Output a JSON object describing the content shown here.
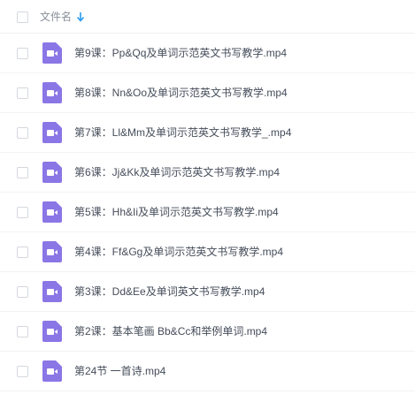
{
  "header": {
    "column_label": "文件名",
    "sort_icon": "arrow-down-icon",
    "sort_color": "#2b9cf2"
  },
  "file_icon": {
    "type": "video-file-icon",
    "color": "#8b76e6"
  },
  "files": [
    {
      "name": "第9课：Pp&Qq及单词示范英文书写教学.mp4"
    },
    {
      "name": "第8课：Nn&Oo及单词示范英文书写教学.mp4"
    },
    {
      "name": "第7课：Ll&Mm及单词示范英文书写教学_.mp4"
    },
    {
      "name": "第6课：Jj&Kk及单词示范英文书写教学.mp4"
    },
    {
      "name": "第5课：Hh&Ii及单词示范英文书写教学.mp4"
    },
    {
      "name": "第4课：Ff&Gg及单词示范英文书写教学.mp4"
    },
    {
      "name": "第3课：Dd&Ee及单词英文书写教学.mp4"
    },
    {
      "name": "第2课：基本笔画 Bb&Cc和举例单词.mp4"
    },
    {
      "name": "第24节 一首诗.mp4"
    }
  ]
}
